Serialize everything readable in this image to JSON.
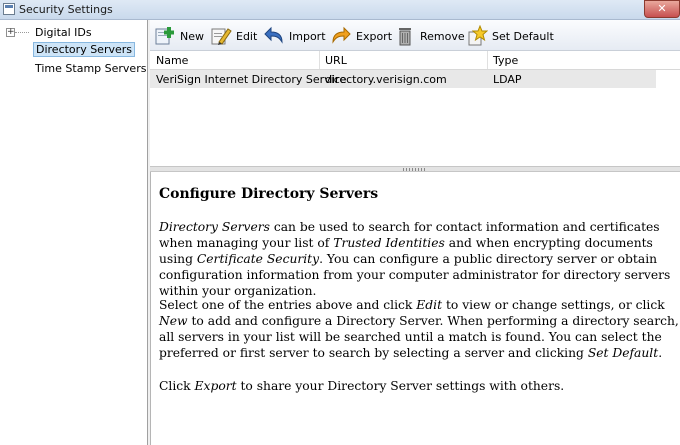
{
  "window": {
    "title": "Security Settings",
    "close_label": "✕"
  },
  "sidebar": {
    "items": [
      {
        "label": "Digital IDs",
        "expander": "+"
      },
      {
        "label": "Directory Servers"
      },
      {
        "label": "Time Stamp Servers"
      }
    ]
  },
  "toolbar": {
    "new_label": "New",
    "edit_label": "Edit",
    "import_label": "Import",
    "export_label": "Export",
    "remove_label": "Remove",
    "set_default_label": "Set Default"
  },
  "table": {
    "columns": [
      "Name",
      "URL",
      "Type"
    ],
    "rows": [
      [
        "VeriSign Internet Directory Service",
        "directory.verisign.com",
        "LDAP"
      ]
    ]
  },
  "help": {
    "heading": "Configure Directory Servers",
    "p1": {
      "a": "Directory Servers",
      "b": " can be used to search for contact information and certificates when managing your list of ",
      "c": "Trusted Identities",
      "d": " and when encrypting documents using ",
      "e": "Certificate Security",
      "f": ". You can configure a public directory server or obtain configuration information from your computer administrator for directory servers within your organization."
    },
    "p2": {
      "a": "Select one of the entries above and click ",
      "b": "Edit",
      "c": " to view or change settings, or click ",
      "d": "New",
      "e": " to add and configure a Directory Server. When performing a directory search, all servers in your list will be searched until a match is found. You can select the preferred or first server to search by selecting a server and clicking ",
      "f": "Set Default",
      "g": "."
    },
    "p3": {
      "a": "Click ",
      "b": "Export",
      "c": " to share your Directory Server settings with others."
    }
  }
}
